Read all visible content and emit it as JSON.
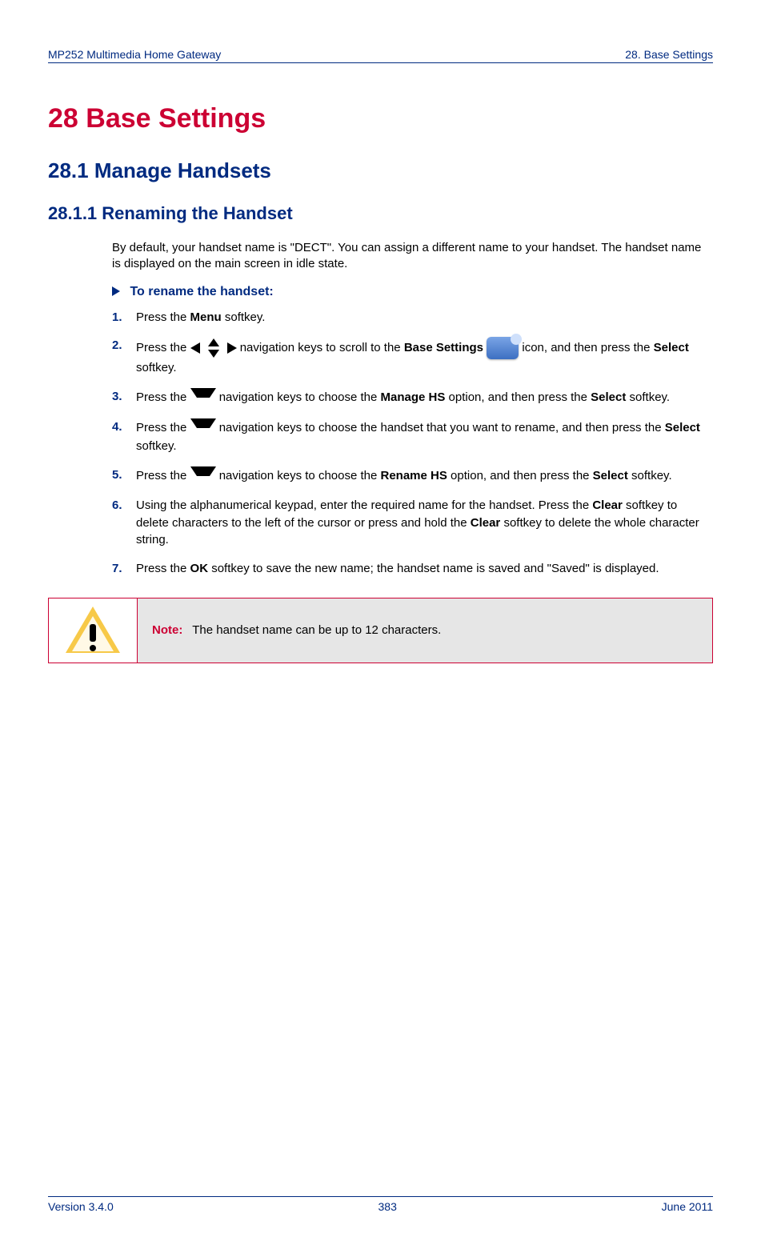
{
  "header": {
    "left": "MP252 Multimedia Home Gateway",
    "right": "28. Base Settings"
  },
  "chapter": {
    "num": "28",
    "title": "Base Settings",
    "full": "28  Base Settings"
  },
  "section": {
    "num": "28.1",
    "title": "Manage Handsets",
    "full": "28.1  Manage Handsets"
  },
  "subsection": {
    "num": "28.1.1",
    "title": "Renaming the Handset",
    "full": "28.1.1  Renaming the Handset"
  },
  "intro": "By default, your handset name is \"DECT\". You can assign a different name to your handset. The handset name is displayed on the main screen in idle state.",
  "procedureTitle": "To rename the handset:",
  "steps": [
    {
      "pre": "Press the ",
      "bold1": "Menu",
      "post": " softkey."
    },
    {
      "pre": "Press the ",
      "iconA": "nav-lr-icon",
      "mid": " navigation keys to scroll to the ",
      "bold1": "Base Settings",
      "iconB": "settings-icon",
      "post2": " icon, and then press the ",
      "bold2": "Select",
      "post3": " softkey."
    },
    {
      "pre": "Press the ",
      "iconA": "nav-down-icon",
      "mid": " navigation keys to choose the ",
      "bold1": "Manage HS",
      "post2": " option, and then press the ",
      "bold2": "Select",
      "post3": " softkey."
    },
    {
      "pre": "Press the ",
      "iconA": "nav-down-icon",
      "mid": " navigation keys to choose the handset that you want to rename, and then press the ",
      "bold1": "Select",
      "post": " softkey."
    },
    {
      "pre": "Press the ",
      "iconA": "nav-down-icon",
      "mid": " navigation keys to choose the ",
      "bold1": "Rename HS",
      "post2": " option, and then press the ",
      "bold2": "Select",
      "post3": " softkey."
    },
    {
      "pre": "Using the alphanumerical keypad, enter the required name for the handset. Press the ",
      "bold1": "Clear",
      "mid": " softkey to delete characters to the left of the cursor or press and hold the ",
      "bold2": "Clear",
      "post3": " softkey to delete the whole character string."
    },
    {
      "pre": "Press the ",
      "bold1": "OK",
      "post": " softkey to save the new name; the handset name is saved and \"Saved\" is displayed."
    }
  ],
  "note": {
    "label": "Note:",
    "text": "The handset name can be up to 12 characters."
  },
  "footer": {
    "left": "Version 3.4.0",
    "center": "383",
    "right": "June 2011"
  }
}
